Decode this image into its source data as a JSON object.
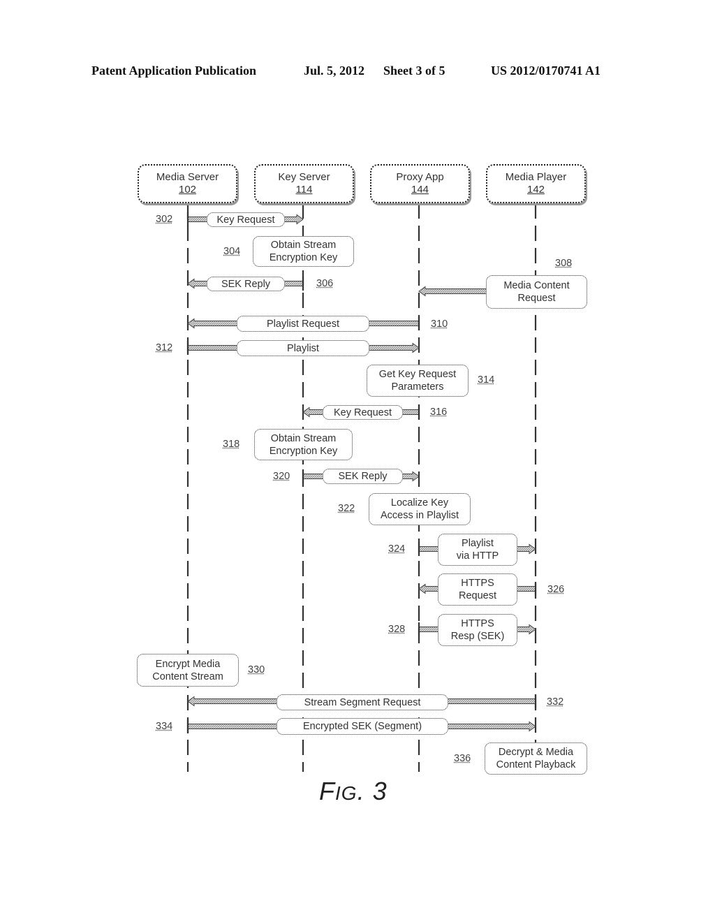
{
  "header": {
    "left": "Patent Application Publication",
    "date": "Jul. 5, 2012",
    "sheet": "Sheet 3 of 5",
    "number": "US 2012/0170741 A1"
  },
  "participants": [
    {
      "name": "Media Server",
      "ref": "102"
    },
    {
      "name": "Key Server",
      "ref": "114"
    },
    {
      "name": "Proxy App",
      "ref": "144"
    },
    {
      "name": "Media Player",
      "ref": "142"
    }
  ],
  "steps": [
    {
      "ref": "302",
      "label": "Key Request",
      "type": "message",
      "from": "Media Server",
      "to": "Key Server"
    },
    {
      "ref": "304",
      "label": "Obtain Stream Encryption Key",
      "type": "process",
      "on": "Key Server"
    },
    {
      "ref": "306",
      "label": "SEK Reply",
      "type": "message",
      "from": "Key Server",
      "to": "Media Server"
    },
    {
      "ref": "308",
      "label": "Media Content Request",
      "type": "message",
      "from": "Media Player",
      "to": "Proxy App"
    },
    {
      "ref": "310",
      "label": "Playlist Request",
      "type": "message",
      "from": "Proxy App",
      "to": "Media Server"
    },
    {
      "ref": "312",
      "label": "Playlist",
      "type": "message",
      "from": "Media Server",
      "to": "Proxy App"
    },
    {
      "ref": "314",
      "label": "Get Key Request Parameters",
      "type": "process",
      "on": "Proxy App"
    },
    {
      "ref": "316",
      "label": "Key Request",
      "type": "message",
      "from": "Proxy App",
      "to": "Key Server"
    },
    {
      "ref": "318",
      "label": "Obtain Stream Encryption Key",
      "type": "process",
      "on": "Key Server"
    },
    {
      "ref": "320",
      "label": "SEK Reply",
      "type": "message",
      "from": "Key Server",
      "to": "Proxy App"
    },
    {
      "ref": "322",
      "label": "Localize Key Access in Playlist",
      "type": "process",
      "on": "Proxy App"
    },
    {
      "ref": "324",
      "label": "Playlist via HTTP",
      "type": "message",
      "from": "Proxy App",
      "to": "Media Player"
    },
    {
      "ref": "326",
      "label": "HTTPS Request",
      "type": "message",
      "from": "Media Player",
      "to": "Proxy App"
    },
    {
      "ref": "328",
      "label": "HTTPS Resp (SEK)",
      "type": "message",
      "from": "Proxy App",
      "to": "Media Player"
    },
    {
      "ref": "330",
      "label": "Encrypt Media Content Stream",
      "type": "process",
      "on": "Media Server"
    },
    {
      "ref": "332",
      "label": "Stream Segment Request",
      "type": "message",
      "from": "Media Player",
      "to": "Media Server"
    },
    {
      "ref": "334",
      "label": "Encrypted SEK (Segment)",
      "type": "message",
      "from": "Media Server",
      "to": "Media Player"
    },
    {
      "ref": "336",
      "label": "Decrypt & Media Content Playback",
      "type": "process",
      "on": "Media Player"
    }
  ],
  "lines": {
    "304": [
      "Obtain Stream",
      "Encryption Key"
    ],
    "308": [
      "Media Content",
      "Request"
    ],
    "314": [
      "Get Key Request",
      "Parameters"
    ],
    "318": [
      "Obtain Stream",
      "Encryption Key"
    ],
    "322": [
      "Localize Key",
      "Access in Playlist"
    ],
    "324": [
      "Playlist",
      "via HTTP"
    ],
    "326": [
      "HTTPS",
      "Request"
    ],
    "328": [
      "HTTPS",
      "Resp (SEK)"
    ],
    "330": [
      "Encrypt Media",
      "Content Stream"
    ],
    "336": [
      "Decrypt & Media",
      "Content Playback"
    ]
  },
  "figure": {
    "prefix": "F",
    "smallcaps": "IG",
    "number": ". 3"
  }
}
